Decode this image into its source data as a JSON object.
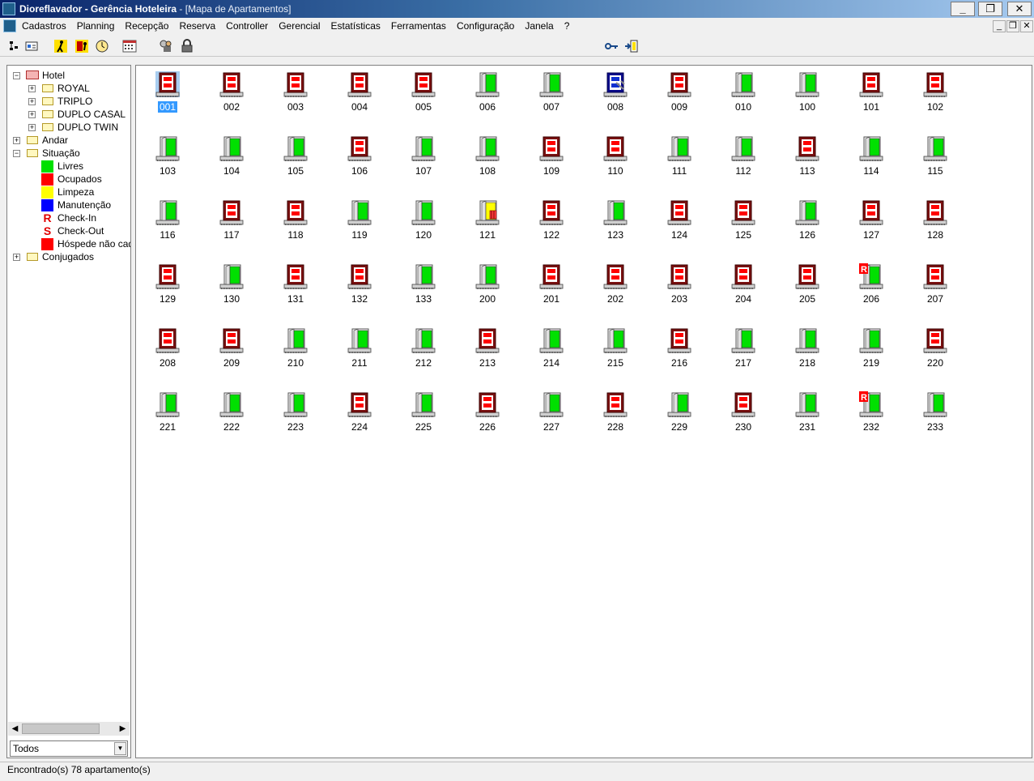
{
  "window": {
    "title": "Dioreflavador - Gerência Hoteleira",
    "subtitle": "- [Mapa de Apartamentos]",
    "controls": [
      "_",
      "❐",
      "✕"
    ]
  },
  "menu": [
    "Cadastros",
    "Planning",
    "Recepção",
    "Reserva",
    "Controller",
    "Gerencial",
    "Estatísticas",
    "Ferramentas",
    "Configuração",
    "Janela",
    "?"
  ],
  "mdi_controls": [
    "_",
    "❐",
    "✕"
  ],
  "toolbar": {
    "left_icons": [
      "tree-view-icon",
      "card-icon",
      "person-walk-icon",
      "exit-person-icon",
      "clock-icon",
      "calendar-icon",
      "search-user-icon",
      "lock-icon"
    ],
    "right_icons": [
      "key-icon",
      "door-exit-icon"
    ]
  },
  "tree": {
    "root": "Hotel",
    "types": [
      "ROYAL",
      "TRIPLO",
      "DUPLO CASAL",
      "DUPLO TWIN"
    ],
    "andar": "Andar",
    "situacao": "Situação",
    "legend": [
      {
        "label": "Livres",
        "kind": "swatch",
        "color": "#00e000"
      },
      {
        "label": "Ocupados",
        "kind": "swatch",
        "color": "#ff0000"
      },
      {
        "label": "Limpeza",
        "kind": "swatch",
        "color": "#ffff00"
      },
      {
        "label": "Manutenção",
        "kind": "swatch",
        "color": "#0000ff"
      },
      {
        "label": "Check-In",
        "kind": "letter",
        "glyph": "R"
      },
      {
        "label": "Check-Out",
        "kind": "letter",
        "glyph": "S"
      },
      {
        "label": "Hóspede não cada",
        "kind": "swatch",
        "color": "#ff0000"
      }
    ],
    "conjugados": "Conjugados"
  },
  "filter": {
    "value": "Todos"
  },
  "rooms": [
    {
      "n": "001",
      "s": "occupied",
      "selected": true
    },
    {
      "n": "002",
      "s": "occupied"
    },
    {
      "n": "003",
      "s": "occupied"
    },
    {
      "n": "004",
      "s": "occupied"
    },
    {
      "n": "005",
      "s": "occupied"
    },
    {
      "n": "006",
      "s": "free"
    },
    {
      "n": "007",
      "s": "free"
    },
    {
      "n": "008",
      "s": "maintenance"
    },
    {
      "n": "009",
      "s": "occupied"
    },
    {
      "n": "010",
      "s": "free"
    },
    {
      "n": "100",
      "s": "free"
    },
    {
      "n": "101",
      "s": "occupied"
    },
    {
      "n": "102",
      "s": "occupied"
    },
    {
      "n": "103",
      "s": "free"
    },
    {
      "n": "104",
      "s": "free"
    },
    {
      "n": "105",
      "s": "free"
    },
    {
      "n": "106",
      "s": "occupied"
    },
    {
      "n": "107",
      "s": "free"
    },
    {
      "n": "108",
      "s": "free"
    },
    {
      "n": "109",
      "s": "occupied"
    },
    {
      "n": "110",
      "s": "occupied"
    },
    {
      "n": "111",
      "s": "free"
    },
    {
      "n": "112",
      "s": "free"
    },
    {
      "n": "113",
      "s": "occupied"
    },
    {
      "n": "114",
      "s": "free"
    },
    {
      "n": "115",
      "s": "free"
    },
    {
      "n": "116",
      "s": "free"
    },
    {
      "n": "117",
      "s": "occupied"
    },
    {
      "n": "118",
      "s": "occupied"
    },
    {
      "n": "119",
      "s": "free"
    },
    {
      "n": "120",
      "s": "free"
    },
    {
      "n": "121",
      "s": "cleaning"
    },
    {
      "n": "122",
      "s": "occupied"
    },
    {
      "n": "123",
      "s": "free"
    },
    {
      "n": "124",
      "s": "occupied"
    },
    {
      "n": "125",
      "s": "occupied"
    },
    {
      "n": "126",
      "s": "free"
    },
    {
      "n": "127",
      "s": "occupied"
    },
    {
      "n": "128",
      "s": "occupied"
    },
    {
      "n": "129",
      "s": "occupied"
    },
    {
      "n": "130",
      "s": "free"
    },
    {
      "n": "131",
      "s": "occupied"
    },
    {
      "n": "132",
      "s": "occupied"
    },
    {
      "n": "133",
      "s": "free"
    },
    {
      "n": "200",
      "s": "free"
    },
    {
      "n": "201",
      "s": "occupied"
    },
    {
      "n": "202",
      "s": "occupied"
    },
    {
      "n": "203",
      "s": "occupied"
    },
    {
      "n": "204",
      "s": "occupied"
    },
    {
      "n": "205",
      "s": "occupied"
    },
    {
      "n": "206",
      "s": "checkin"
    },
    {
      "n": "207",
      "s": "occupied"
    },
    {
      "n": "208",
      "s": "occupied"
    },
    {
      "n": "209",
      "s": "occupied"
    },
    {
      "n": "210",
      "s": "free"
    },
    {
      "n": "211",
      "s": "free"
    },
    {
      "n": "212",
      "s": "free"
    },
    {
      "n": "213",
      "s": "occupied"
    },
    {
      "n": "214",
      "s": "free"
    },
    {
      "n": "215",
      "s": "free"
    },
    {
      "n": "216",
      "s": "occupied"
    },
    {
      "n": "217",
      "s": "free"
    },
    {
      "n": "218",
      "s": "free"
    },
    {
      "n": "219",
      "s": "free"
    },
    {
      "n": "220",
      "s": "occupied"
    },
    {
      "n": "221",
      "s": "free"
    },
    {
      "n": "222",
      "s": "free"
    },
    {
      "n": "223",
      "s": "free"
    },
    {
      "n": "224",
      "s": "occupied"
    },
    {
      "n": "225",
      "s": "free"
    },
    {
      "n": "226",
      "s": "occupied"
    },
    {
      "n": "227",
      "s": "free"
    },
    {
      "n": "228",
      "s": "occupied"
    },
    {
      "n": "229",
      "s": "free"
    },
    {
      "n": "230",
      "s": "occupied"
    },
    {
      "n": "231",
      "s": "free"
    },
    {
      "n": "232",
      "s": "checkin"
    },
    {
      "n": "233",
      "s": "free"
    }
  ],
  "status": {
    "text": "Encontrado(s) 78 apartamento(s)"
  }
}
